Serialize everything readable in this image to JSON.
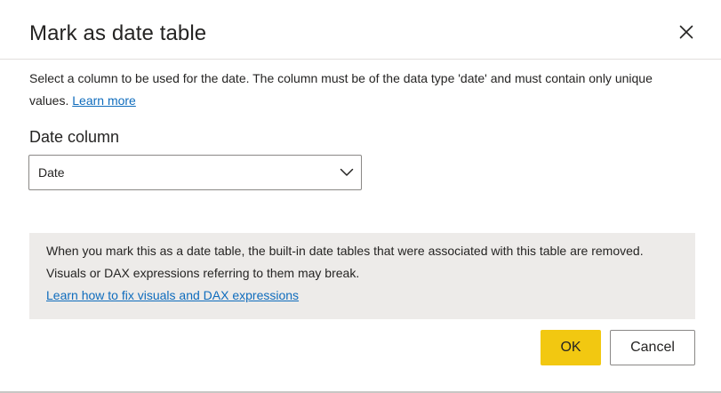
{
  "dialog": {
    "title": "Mark as date table",
    "description": "Select a column to be used for the date. The column must be of the data type 'date' and must contain only unique values.",
    "learn_more_link": "Learn more",
    "field_label": "Date column",
    "date_column_value": "Date",
    "warning_text": "When you mark this as a date table, the built-in date tables that were associated with this table are removed. Visuals or DAX expressions referring to them may break.",
    "warning_link": "Learn how to fix visuals and DAX expressions",
    "ok_label": "OK",
    "cancel_label": "Cancel"
  },
  "icons": {
    "close": "close-icon",
    "dropdown": "chevron-down-icon"
  },
  "colors": {
    "primary_button": "#f2c811",
    "link": "#0f6cbd",
    "warning_background": "#edebe9"
  }
}
